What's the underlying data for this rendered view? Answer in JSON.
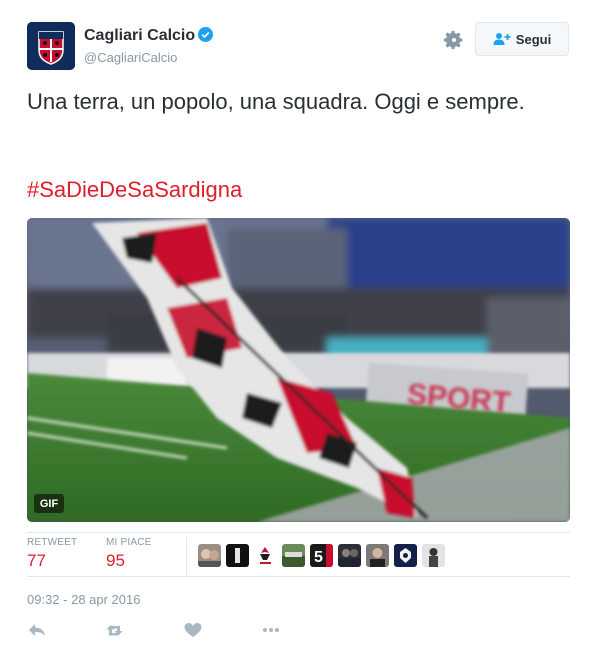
{
  "author": {
    "name": "Cagliari Calcio",
    "handle": "@CagliariCalcio",
    "avatar_icon": "cagliari-crest-icon",
    "verified_icon": "verified-badge-icon"
  },
  "actions_top": {
    "settings_icon": "gear-icon",
    "follow_icon": "add-user-icon",
    "follow_label": "Segui"
  },
  "tweet": {
    "text": "Una terra, un popolo, una squadra. Oggi e sempre.",
    "hashtag": "#SaDieDeSaSardigna"
  },
  "media": {
    "badge": "GIF",
    "banner_text": "SPORT"
  },
  "stats": {
    "retweet_label": "RETWEET",
    "retweet_count": "77",
    "likes_label": "MI PIACE",
    "likes_count": "95"
  },
  "timestamp": "09:32 - 28 apr 2016",
  "colors": {
    "brand_red": "#e01e2b",
    "link_blue": "#1da1f2",
    "muted": "#8899a6"
  },
  "bottom_actions": [
    "reply-icon",
    "retweet-icon",
    "like-icon",
    "more-icon"
  ]
}
